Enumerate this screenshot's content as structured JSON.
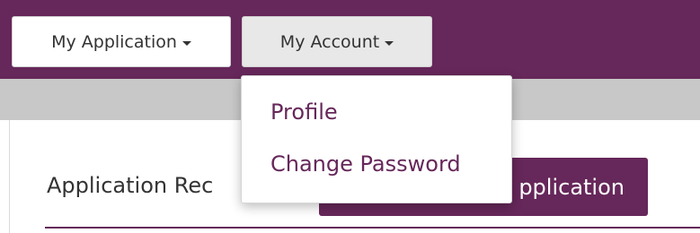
{
  "navbar": {
    "my_application_label": "My Application",
    "my_account_label": "My Account",
    "brand_color": "#66275a"
  },
  "account_menu": {
    "items": [
      {
        "label": "Profile"
      },
      {
        "label": "Change Password"
      }
    ]
  },
  "content": {
    "section_label": "Application Rec",
    "button_label": "pplication"
  }
}
